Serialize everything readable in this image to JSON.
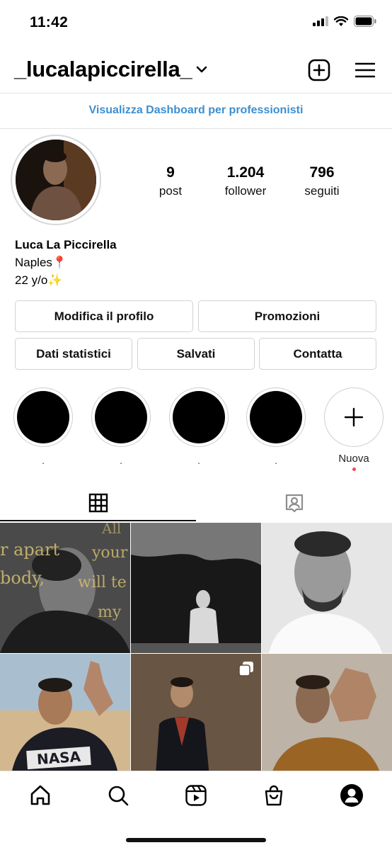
{
  "status_bar": {
    "time": "11:42"
  },
  "header": {
    "username": "_lucalapiccirella_",
    "icons": {
      "dropdown": "chevron-down-icon",
      "create": "plus-square-icon",
      "menu": "hamburger-menu-icon"
    }
  },
  "dashboard_link": "Visualizza Dashboard per professionisti",
  "profile": {
    "stats": [
      {
        "value": "9",
        "label": "post"
      },
      {
        "value": "1.204",
        "label": "follower"
      },
      {
        "value": "796",
        "label": "seguiti"
      }
    ],
    "name": "Luca La Piccirella",
    "bio_line1": "Naples📍",
    "bio_line2": "22 y/o✨"
  },
  "buttons": {
    "edit_profile": "Modifica il profilo",
    "promotions": "Promozioni",
    "insights": "Dati statistici",
    "saved": "Salvati",
    "contact": "Contatta"
  },
  "highlights": [
    {
      "label": "."
    },
    {
      "label": "."
    },
    {
      "label": "."
    },
    {
      "label": "."
    }
  ],
  "new_highlight": {
    "label": "Nuova"
  },
  "tabs": {
    "active": "grid",
    "items": [
      "grid-icon",
      "tagged-icon"
    ]
  },
  "posts": [
    {
      "kind": "photo",
      "overlay_text": [
        "r apart",
        "body,",
        "your",
        "will te",
        "my",
        "All"
      ]
    },
    {
      "kind": "photo"
    },
    {
      "kind": "photo"
    },
    {
      "kind": "photo",
      "shirt_text": "NASA"
    },
    {
      "kind": "carousel"
    },
    {
      "kind": "photo"
    }
  ],
  "bottom_nav": [
    "home-icon",
    "search-icon",
    "reels-icon",
    "shop-icon",
    "profile-icon"
  ]
}
